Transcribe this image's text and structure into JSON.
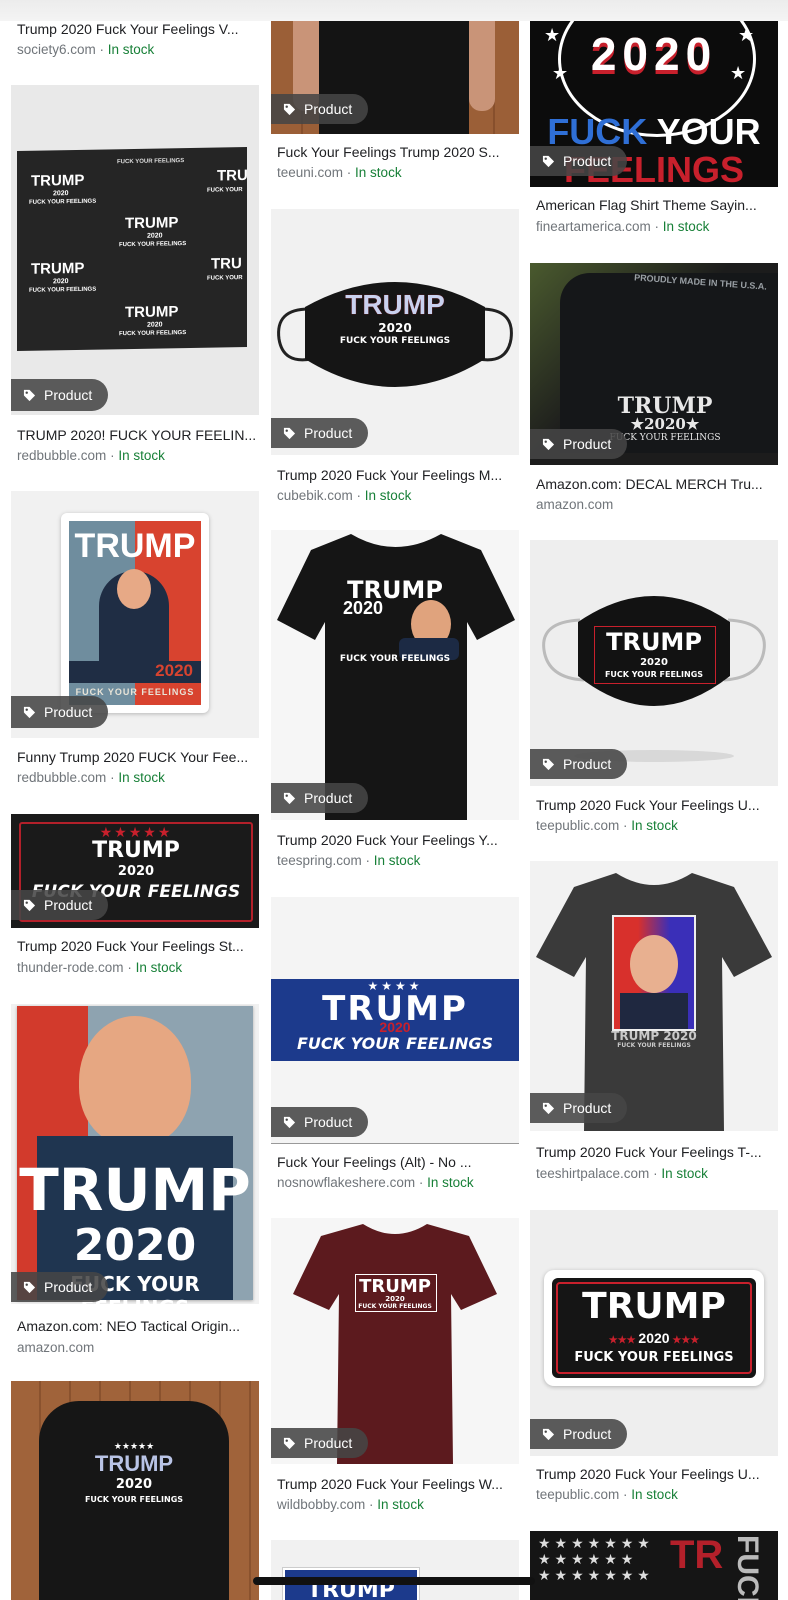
{
  "badge_label": "Product",
  "colors": {
    "in_stock": "#188038",
    "meta_gray": "#70757a",
    "badge_bg": "#464646"
  },
  "icons": {
    "badge": "tag-icon"
  },
  "col1": [
    {
      "title": "Trump 2020 Fuck Your Feelings V...",
      "source": "society6.com",
      "stock": "In stock"
    },
    {
      "title": "TRUMP 2020! FUCK YOUR FEELIN...",
      "source": "redbubble.com",
      "stock": "In stock",
      "img_text": [
        "FUCK YOUR FEELINGS",
        "TRUMP",
        "2020",
        "FUCK YOUR FEELINGS",
        "TRU",
        "FUCK YOUR",
        "TRUMP",
        "2020",
        "FUCK YOUR FEELINGS",
        "TRUMP",
        "2020",
        "FUCK YOUR FEELINGS",
        "TRU",
        "FUCK YOUR",
        "TRUMP",
        "2020",
        "FUCK YOUR FEELINGS"
      ]
    },
    {
      "title": "Funny Trump 2020 FUCK Your Fee...",
      "source": "redbubble.com",
      "stock": "In stock",
      "img_text": [
        "TRUMP",
        "2020",
        "FUCK YOUR FEELINGS"
      ]
    },
    {
      "title": "Trump 2020 Fuck Your Feelings St...",
      "source": "thunder-rode.com",
      "stock": "In stock",
      "img_text": [
        "TRUMP",
        "2020",
        "FUCK YOUR FEELINGS"
      ]
    },
    {
      "title": "Amazon.com: NEO Tactical Origin...",
      "source": "amazon.com",
      "stock": "",
      "img_text": [
        "TRUMP",
        "2020",
        "FUCK YOUR FEELINGS"
      ]
    },
    {
      "title": "",
      "source": "",
      "stock": "",
      "img_text": [
        "TRUMP",
        "2020",
        "FUCK YOUR FEELINGS"
      ]
    }
  ],
  "col2": [
    {
      "title": "Fuck Your Feelings Trump 2020 S...",
      "source": "teeuni.com",
      "stock": "In stock"
    },
    {
      "title": "Trump 2020 Fuck Your Feelings M...",
      "source": "cubebik.com",
      "stock": "In stock",
      "img_text": [
        "TRUMP",
        "2020",
        "FUCK YOUR FEELINGS"
      ]
    },
    {
      "title": "Trump 2020 Fuck Your Feelings Y...",
      "source": "teespring.com",
      "stock": "In stock",
      "img_text": [
        "TRUMP",
        "2020",
        "FUCK YOUR FEELINGS"
      ]
    },
    {
      "title": "Fuck Your Feelings (Alt) - No ...",
      "source": "nosnowflakeshere.com",
      "stock": "In stock",
      "img_text": [
        "TRUMP",
        "2020",
        "FUCK YOUR FEELINGS"
      ]
    },
    {
      "title": "Trump 2020 Fuck Your Feelings W...",
      "source": "wildbobby.com",
      "stock": "In stock",
      "img_text": [
        "TRUMP",
        "2020",
        "FUCK YOUR FEELINGS"
      ]
    },
    {
      "title": "",
      "source": "",
      "stock": "",
      "img_text": [
        "TRUMP"
      ]
    }
  ],
  "col3": [
    {
      "title": "American Flag Shirt Theme Sayin...",
      "source": "fineartamerica.com",
      "stock": "In stock",
      "img_text": [
        "2020",
        "FUCK YOUR",
        "FEELINGS"
      ]
    },
    {
      "title": "Amazon.com: DECAL MERCH Tru...",
      "source": "amazon.com",
      "stock": "",
      "img_text": [
        "PROUDLY MADE IN THE U.S.A.",
        "TRUMP",
        "2020",
        "FUCK YOUR FEELINGS"
      ]
    },
    {
      "title": "Trump 2020 Fuck Your Feelings U...",
      "source": "teepublic.com",
      "stock": "In stock",
      "img_text": [
        "TRUMP",
        "2020",
        "FUCK YOUR FEELINGS"
      ]
    },
    {
      "title": "Trump 2020 Fuck Your Feelings T-...",
      "source": "teeshirtpalace.com",
      "stock": "In stock",
      "img_text": [
        "TRUMP 2020",
        "FUCK YOUR FEELINGS"
      ]
    },
    {
      "title": "Trump 2020 Fuck Your Feelings U...",
      "source": "teepublic.com",
      "stock": "In stock",
      "img_text": [
        "TRUMP",
        "2020",
        "FUCK YOUR FEELINGS"
      ]
    },
    {
      "title": "",
      "source": "",
      "stock": "",
      "img_text": [
        "TR",
        "FUCK"
      ]
    }
  ],
  "separator": " · "
}
